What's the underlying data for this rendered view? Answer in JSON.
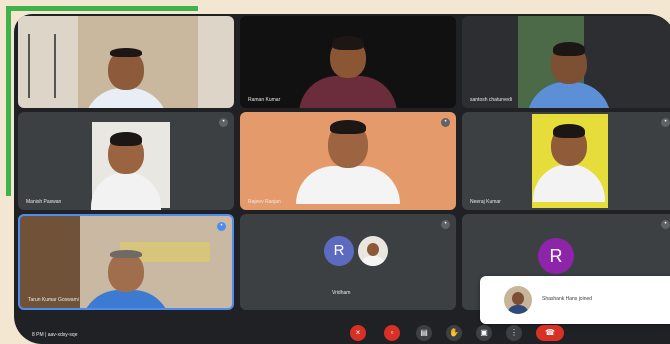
{
  "participants": [
    {
      "name": "",
      "mic_icon": "mic-icon"
    },
    {
      "name": "Raman Kumar",
      "mic_icon": "mic-icon"
    },
    {
      "name": "santosh chaturvedi",
      "mic_icon": "mic-icon"
    },
    {
      "name": "Manish Paswan",
      "mic_icon": "mic-icon"
    },
    {
      "name": "Rajeev Ranjan",
      "mic_icon": "mic-icon"
    },
    {
      "name": "Neeraj Kumar",
      "mic_icon": "mic-icon"
    },
    {
      "name": "Tarun Kumar Goswami",
      "mic_icon": "mic-icon"
    },
    {
      "name": "Vridham",
      "avatar_letter": "R",
      "mic_icon": "mic-icon"
    },
    {
      "name": "",
      "avatar_letter": "R",
      "mic_icon": "mic-icon"
    }
  ],
  "toast": {
    "text": "Shashank Hans joined"
  },
  "bottom": {
    "time": "8 PM  |  aav-xdsy-sqe"
  },
  "colors": {
    "accent_green": "#3fb24a",
    "end_call": "#d93025",
    "avatar_blue": "#5c6bc0",
    "avatar_purple": "#8e24aa"
  }
}
